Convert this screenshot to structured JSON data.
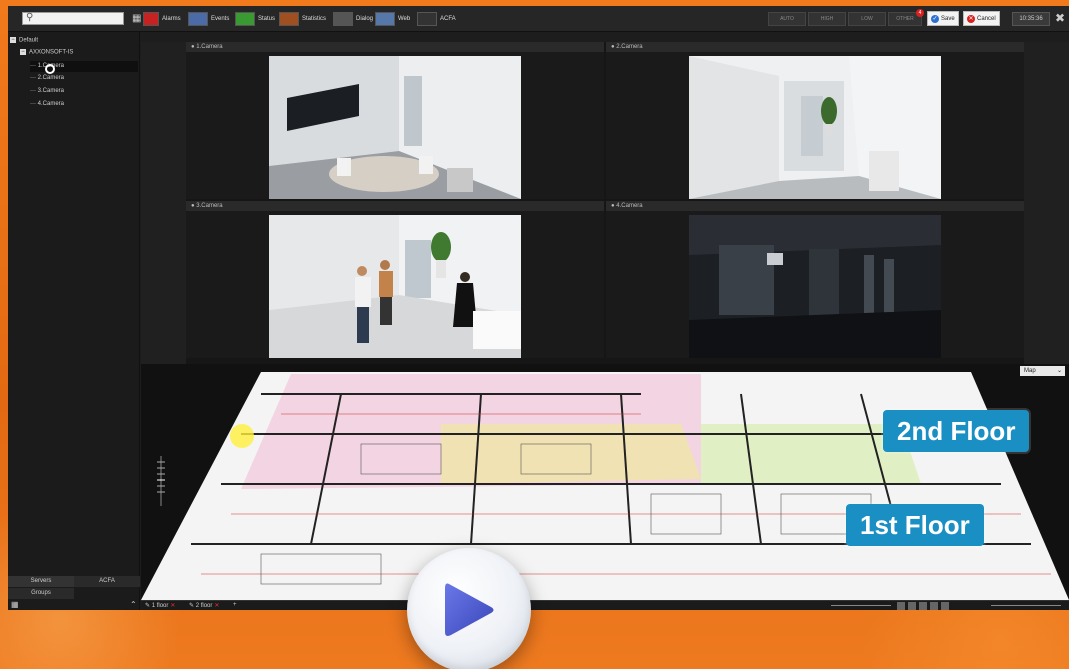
{
  "toolbar": {
    "search_placeholder": "",
    "buttons": [
      {
        "label": "Alarms",
        "icon": "bell-icon",
        "color": "#c62222"
      },
      {
        "label": "Events",
        "icon": "events-icon",
        "color": "#4a6aa8"
      },
      {
        "label": "Status",
        "icon": "status-icon",
        "color": "#3a9a32"
      },
      {
        "label": "Statistics",
        "icon": "statistics-icon",
        "color": "#a05020"
      },
      {
        "label": "Dialog",
        "icon": "dialog-icon",
        "color": "#555555"
      },
      {
        "label": "Web",
        "icon": "web-icon",
        "color": "#5577aa"
      },
      {
        "label": "ACFA",
        "icon": "acfa-icon",
        "color": "#333333"
      }
    ],
    "modes": [
      "AUTO",
      "HIGH",
      "LOW",
      "OTHER"
    ],
    "mode_badge": "4",
    "save_label": "Save",
    "cancel_label": "Cancel",
    "clock": "10:35:36"
  },
  "sidebar": {
    "root": "Default",
    "server": "AXXONSOFT-IS",
    "cameras": [
      "1.Camera",
      "2.Camera",
      "3.Camera",
      "4.Camera"
    ],
    "tab_servers": "Servers",
    "tab_acfa": "ACFA",
    "tab_groups": "Groups"
  },
  "cameras": [
    {
      "title": "1.Camera"
    },
    {
      "title": "2.Camera"
    },
    {
      "title": "3.Camera"
    },
    {
      "title": "4.Camera"
    }
  ],
  "map": {
    "map_button": "Map",
    "floor_upper": "2nd Floor",
    "floor_lower": "1st Floor",
    "floor_tabs": [
      "1 floor",
      "2 floor"
    ]
  },
  "colors": {
    "accent_orange": "#e8731a",
    "floor_label": "#1a8fc4",
    "save_blue": "#2c6fd0",
    "cancel_red": "#d82020"
  }
}
